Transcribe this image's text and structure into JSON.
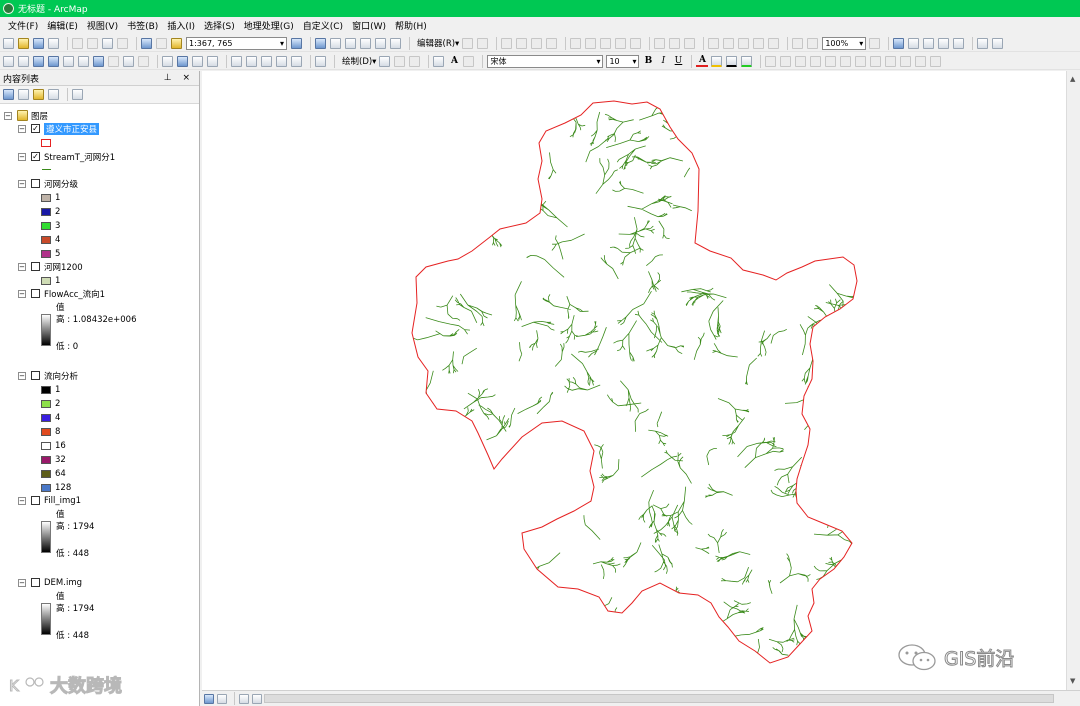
{
  "window": {
    "title": "无标题 - ArcMap"
  },
  "menu": [
    "文件(F)",
    "编辑(E)",
    "视图(V)",
    "书签(B)",
    "插入(I)",
    "选择(S)",
    "地理处理(G)",
    "自定义(C)",
    "窗口(W)",
    "帮助(H)"
  ],
  "toolbar": {
    "scale": "1:367, 765",
    "editor_label": "编辑器(R)▾",
    "draw_label": "绘制(D)▾",
    "font_name": "宋体",
    "font_size": "10",
    "bold": "B",
    "italic": "I",
    "underline": "U",
    "text_color_label": "A",
    "zoom_percent": "100%"
  },
  "toc": {
    "title": "内容列表",
    "header_controls": "⊥ ×",
    "root": "图层",
    "layers": [
      {
        "name": "遵义市正安县",
        "checked": true,
        "selected": true
      },
      {
        "name": "StreamT_河网分1",
        "checked": true
      },
      {
        "name": "河网分级",
        "checked": false,
        "classes": [
          {
            "label": "1",
            "color": "#bfb3a8"
          },
          {
            "label": "2",
            "color": "#1919a6"
          },
          {
            "label": "3",
            "color": "#33dd33"
          },
          {
            "label": "4",
            "color": "#c84a2a"
          },
          {
            "label": "5",
            "color": "#b0338a"
          }
        ]
      },
      {
        "name": "河网1200",
        "checked": false,
        "classes": [
          {
            "label": "1",
            "color": "#cfdcb5"
          }
        ]
      },
      {
        "name": "FlowAcc_流向1",
        "checked": false,
        "value_label": "值",
        "high": "高 : 1.08432e+006",
        "low": "低 : 0"
      },
      {
        "name": "流向分析",
        "checked": false,
        "classes": [
          {
            "label": "1",
            "color": "#000000"
          },
          {
            "label": "2",
            "color": "#8ee04a"
          },
          {
            "label": "4",
            "color": "#3a1ee0"
          },
          {
            "label": "8",
            "color": "#e04a1e"
          },
          {
            "label": "16",
            "color": "#ffffff"
          },
          {
            "label": "32",
            "color": "#9a1a6a"
          },
          {
            "label": "64",
            "color": "#5e5e1a"
          },
          {
            "label": "128",
            "color": "#4a78c8"
          }
        ]
      },
      {
        "name": "Fill_img1",
        "checked": false,
        "value_label": "值",
        "high": "高 : 1794",
        "low": "低 : 448"
      },
      {
        "name": "DEM.img",
        "checked": false,
        "value_label": "值",
        "high": "高 : 1794",
        "low": "低 : 448"
      }
    ]
  },
  "map": {
    "boundary_color": "#e52222",
    "stream_color": "#3a8a1a"
  },
  "watermarks": {
    "left": "大数跨境",
    "right": "GIS前沿"
  }
}
